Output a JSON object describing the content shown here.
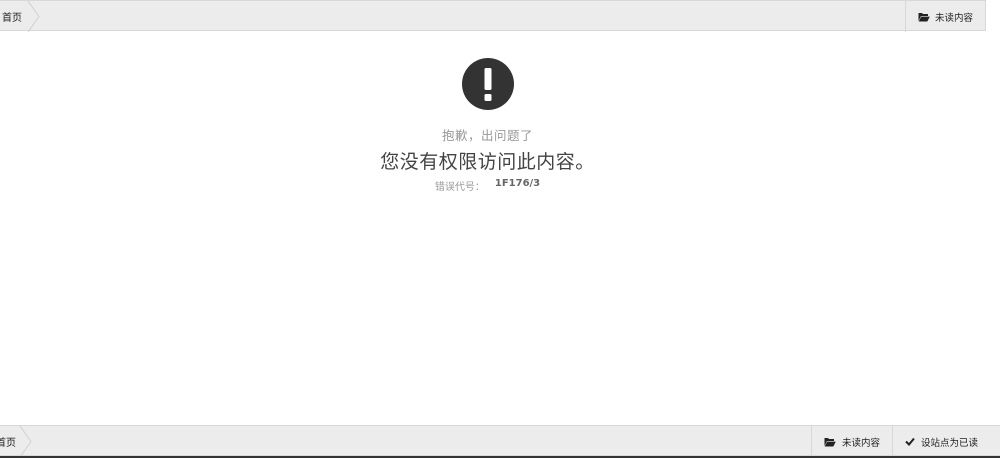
{
  "topbar": {
    "breadcrumb_home": "首页",
    "unread_label": "未读内容"
  },
  "error": {
    "sorry_text": "抱歉，出问题了",
    "message": "您没有权限访问此内容。",
    "code_label": "错误代号：",
    "code_value": "1F176/3"
  },
  "bottombar": {
    "breadcrumb_home": "首页",
    "unread_label": "未读内容",
    "mark_read_label": "设站点为已读"
  },
  "colors": {
    "icon_dark": "#333333",
    "bar_bg": "#ececec"
  },
  "icons": {
    "unread": "folder-open-icon",
    "mark_read": "check-icon",
    "warning": "exclamation-circle-icon"
  }
}
